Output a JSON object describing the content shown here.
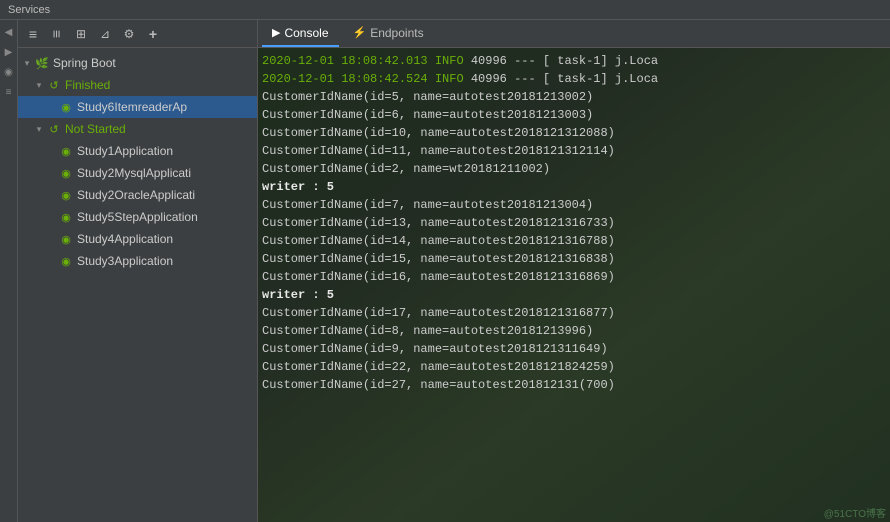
{
  "title_bar": {
    "label": "Services"
  },
  "sidebar": {
    "toolbar_buttons": [
      {
        "id": "expand-all",
        "icon": "≡",
        "label": "Expand All"
      },
      {
        "id": "collapse-all",
        "icon": "≡",
        "label": "Collapse All"
      },
      {
        "id": "group",
        "icon": "⊞",
        "label": "Group"
      },
      {
        "id": "filter",
        "icon": "⊿",
        "label": "Filter"
      },
      {
        "id": "settings",
        "icon": "⚙",
        "label": "Settings"
      },
      {
        "id": "add",
        "icon": "+",
        "label": "Add"
      }
    ],
    "tree": [
      {
        "id": "spring-boot",
        "label": "Spring Boot",
        "indent": 0,
        "arrow": "down",
        "icon": "spring",
        "selected": false
      },
      {
        "id": "finished",
        "label": "Finished",
        "indent": 1,
        "arrow": "down",
        "icon": "running",
        "selected": false
      },
      {
        "id": "study6",
        "label": "Study6ItemreaderAp",
        "indent": 2,
        "arrow": "none",
        "icon": "app",
        "selected": true
      },
      {
        "id": "not-started",
        "label": "Not Started",
        "indent": 1,
        "arrow": "down",
        "icon": "running",
        "selected": false
      },
      {
        "id": "study1",
        "label": "Study1Application",
        "indent": 2,
        "arrow": "none",
        "icon": "app",
        "selected": false
      },
      {
        "id": "study2mysql",
        "label": "Study2MysqlApplicati",
        "indent": 2,
        "arrow": "none",
        "icon": "app",
        "selected": false
      },
      {
        "id": "study2oracle",
        "label": "Study2OracleApplicati",
        "indent": 2,
        "arrow": "none",
        "icon": "app",
        "selected": false
      },
      {
        "id": "study5step",
        "label": "Study5StepApplication",
        "indent": 2,
        "arrow": "none",
        "icon": "app",
        "selected": false
      },
      {
        "id": "study4",
        "label": "Study4Application",
        "indent": 2,
        "arrow": "none",
        "icon": "app",
        "selected": false
      },
      {
        "id": "study3",
        "label": "Study3Application",
        "indent": 2,
        "arrow": "none",
        "icon": "app",
        "selected": false
      }
    ]
  },
  "tabs": [
    {
      "id": "console",
      "label": "Console",
      "active": true
    },
    {
      "id": "endpoints",
      "label": "Endpoints",
      "active": false
    }
  ],
  "console": {
    "lines": [
      {
        "type": "log",
        "text": "2020-12-01 18:08:42.013  INFO 40996 ---  [                 task-1] j.Loca"
      },
      {
        "type": "log",
        "text": "2020-12-01 18:08:42.524  INFO 40996 ---  [                 task-1] j.Loca"
      },
      {
        "type": "customer",
        "text": "CustomerIdName(id=5, name=autotest20181213002)"
      },
      {
        "type": "customer",
        "text": "CustomerIdName(id=6, name=autotest20181213003)"
      },
      {
        "type": "customer",
        "text": "CustomerIdName(id=10, name=autotest2018121312088)"
      },
      {
        "type": "customer",
        "text": "CustomerIdName(id=11, name=autotest2018121312114)"
      },
      {
        "type": "customer",
        "text": "CustomerIdName(id=2, name=wt20181211002)"
      },
      {
        "type": "writer",
        "text": "writer : 5"
      },
      {
        "type": "customer",
        "text": "CustomerIdName(id=7, name=autotest20181213004)"
      },
      {
        "type": "customer",
        "text": "CustomerIdName(id=13, name=autotest2018121316733)"
      },
      {
        "type": "customer",
        "text": "CustomerIdName(id=14, name=autotest2018121316788)"
      },
      {
        "type": "customer",
        "text": "CustomerIdName(id=15, name=autotest2018121316838)"
      },
      {
        "type": "customer",
        "text": "CustomerIdName(id=16, name=autotest2018121316869)"
      },
      {
        "type": "writer",
        "text": "writer : 5"
      },
      {
        "type": "customer",
        "text": "CustomerIdName(id=17, name=autotest2018121316877)"
      },
      {
        "type": "customer",
        "text": "CustomerIdName(id=8, name=autotest20181213996)"
      },
      {
        "type": "customer",
        "text": "CustomerIdName(id=9, name=autotest2018121311649)"
      },
      {
        "type": "customer",
        "text": "CustomerIdName(id=22, name=autotest2018121824259)"
      },
      {
        "type": "customer",
        "text": "CustomerIdName(id=27, name=autotest201812131(700)"
      }
    ],
    "watermark": "@51CTO博客"
  }
}
